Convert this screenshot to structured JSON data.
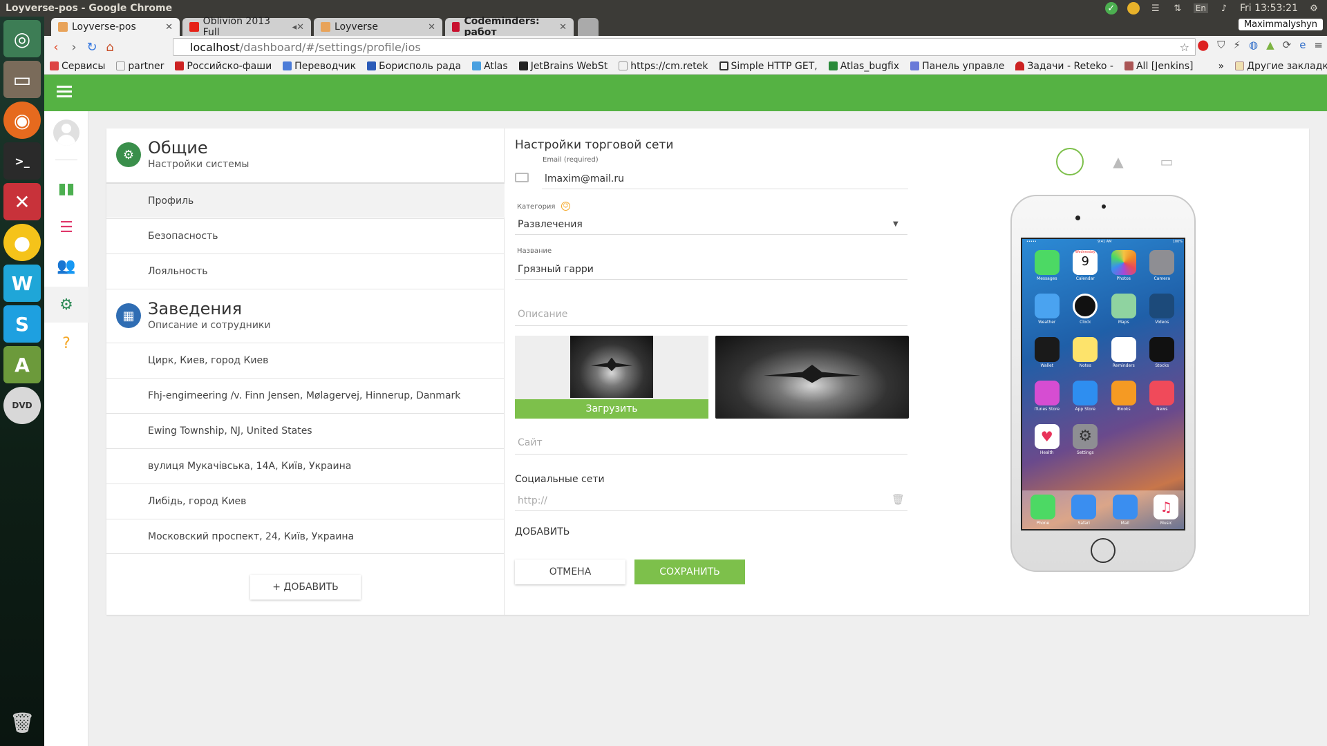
{
  "os": {
    "window_title": "Loyverse-pos - Google Chrome",
    "clock": "Fri 13:53:21",
    "keyboard_layout": "En",
    "user": "Maximmalyshyn"
  },
  "tabs": [
    {
      "label": "Loyverse-pos",
      "active": true,
      "color": "#e8a35a"
    },
    {
      "label": "Oblivion 2013 Full",
      "active": false,
      "color": "#e62117"
    },
    {
      "label": "Loyverse",
      "active": false,
      "color": "#e8a35a"
    },
    {
      "label": "Codeminders: работ",
      "active": false,
      "color": "#c8102e"
    }
  ],
  "address": {
    "host": "localhost",
    "path": "/dashboard/#/settings/profile/ios"
  },
  "bookmarks": [
    "Сервисы",
    "partner",
    "Российско-фаши",
    "Переводчик",
    "Борисполь рада",
    "Atlas",
    "JetBrains WebSt",
    "https://cm.retek",
    "Simple HTTP GET,",
    "Atlas_bugfix",
    "Панель управле",
    "Задачи - Reteko -",
    "All [Jenkins]"
  ],
  "bookmarks_more": "»",
  "bookmarks_other": "Другие закладки",
  "left": {
    "general": {
      "title": "Общие",
      "subtitle": "Настройки системы"
    },
    "general_items": [
      "Профиль",
      "Безопасность",
      "Лояльность"
    ],
    "stores": {
      "title": "Заведения",
      "subtitle": "Описание и сотрудники"
    },
    "store_items": [
      "Цирк, Киев, город Киев",
      "Fhj-engirneering /v. Finn Jensen, Mølagervej, Hinnerup, Danmark",
      "Ewing Township, NJ, United States",
      "вулиця Мукачівська, 14А, Київ, Украина",
      "Либідь, город Киев",
      "Московский проспект, 24, Київ, Украина"
    ],
    "add_label": "+ ДОБАВИТЬ"
  },
  "form": {
    "title": "Настройки торговой сети",
    "email_label": "Email (required)",
    "email_value": "lmaxim@mail.ru",
    "category_label": "Категория",
    "category_value": "Развлечения",
    "name_label": "Название",
    "name_value": "Грязный гарри",
    "description_placeholder": "Описание",
    "upload_label": "Загрузить",
    "site_placeholder": "Сайт",
    "social_label": "Социальные сети",
    "social_placeholder": "http://",
    "add_social_label": "ДОБАВИТЬ",
    "cancel_label": "ОТМЕНА",
    "save_label": "СОХРАНИТЬ"
  },
  "preview": {
    "status_time": "9:41 AM",
    "status_battery": "100%",
    "apps": [
      {
        "label": "Messages",
        "color": "#4cd964"
      },
      {
        "label": "Calendar",
        "color": "#ffffff"
      },
      {
        "label": "Photos",
        "color": "#f5c243"
      },
      {
        "label": "Camera",
        "color": "#8e8e93"
      },
      {
        "label": "Weather",
        "color": "#4aa3f0"
      },
      {
        "label": "Clock",
        "color": "#111111"
      },
      {
        "label": "Maps",
        "color": "#8fd3a0"
      },
      {
        "label": "Videos",
        "color": "#1c4a7a"
      },
      {
        "label": "Wallet",
        "color": "#1a1a1a"
      },
      {
        "label": "Notes",
        "color": "#fde36b"
      },
      {
        "label": "Reminders",
        "color": "#ffffff"
      },
      {
        "label": "Stocks",
        "color": "#111111"
      },
      {
        "label": "iTunes Store",
        "color": "#d64dd2"
      },
      {
        "label": "App Store",
        "color": "#2e8ef0"
      },
      {
        "label": "iBooks",
        "color": "#f59a23"
      },
      {
        "label": "News",
        "color": "#f04a5a"
      },
      {
        "label": "Health",
        "color": "#ffffff"
      },
      {
        "label": "Settings",
        "color": "#8e8e93"
      }
    ],
    "calendar_day": "Wednesday",
    "calendar_date": "9",
    "dock": [
      {
        "label": "Phone",
        "color": "#4cd964"
      },
      {
        "label": "Safari",
        "color": "#3a8ef0"
      },
      {
        "label": "Mail",
        "color": "#3a8ef0"
      },
      {
        "label": "Music",
        "color": "#ffffff"
      }
    ]
  },
  "colors": {
    "brand_green": "#55b243",
    "button_green": "#7dc04b",
    "stores_blue": "#2f6db3",
    "general_green": "#3a8f4b"
  }
}
